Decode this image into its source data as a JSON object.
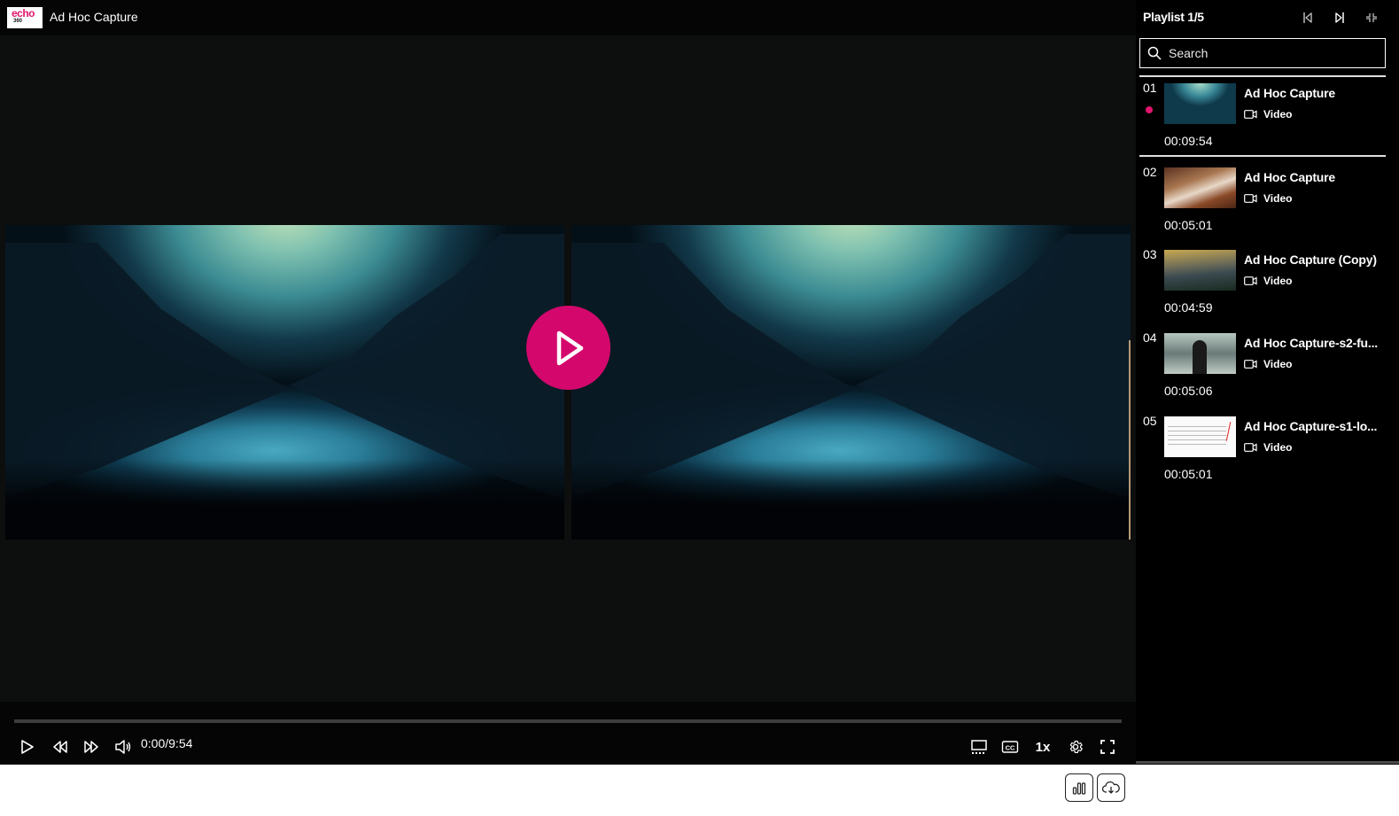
{
  "header": {
    "logo_text": "echo",
    "logo_subtext": "360",
    "title": "Ad Hoc Capture"
  },
  "player": {
    "current_time": "0:00",
    "duration": "9:54",
    "time_display": "0:00/9:54",
    "progress_fraction": 0,
    "speed": "1x",
    "accent_color": "#d4086c",
    "controls": {
      "play": "play-icon",
      "rewind": "rewind-icon",
      "forward": "fast-forward-icon",
      "volume": "volume-icon",
      "layout": "layout-icon",
      "captions": "CC",
      "settings": "gear-icon",
      "fullscreen": "fullscreen-icon"
    }
  },
  "playlist": {
    "title": "Playlist 1/5",
    "search_placeholder": "Search",
    "search_value": "",
    "items": [
      {
        "num": "01",
        "name": "Ad Hoc Capture",
        "type": "Video",
        "duration": "00:09:54",
        "current": true
      },
      {
        "num": "02",
        "name": "Ad Hoc Capture",
        "type": "Video",
        "duration": "00:05:01",
        "current": false
      },
      {
        "num": "03",
        "name": "Ad Hoc Capture (Copy)",
        "type": "Video",
        "duration": "00:04:59",
        "current": false
      },
      {
        "num": "04",
        "name": "Ad Hoc Capture-s2-fu...",
        "type": "Video",
        "duration": "00:05:06",
        "current": false
      },
      {
        "num": "05",
        "name": "Ad Hoc Capture-s1-lo...",
        "type": "Video",
        "duration": "00:05:01",
        "current": false
      }
    ]
  },
  "footer": {
    "analytics_icon": "bar-chart-icon",
    "download_icon": "cloud-download-icon"
  }
}
